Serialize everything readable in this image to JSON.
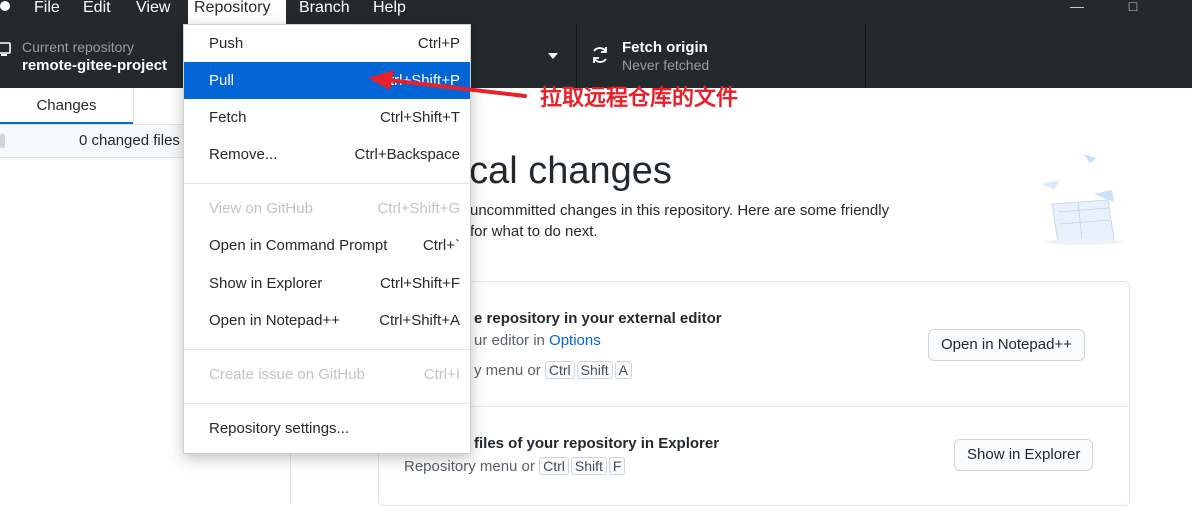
{
  "menubar": {
    "items": [
      "File",
      "Edit",
      "View",
      "Repository",
      "Branch",
      "Help"
    ]
  },
  "toolbar": {
    "current_repo_label": "Current repository",
    "current_repo_value": "remote-gitee-project",
    "fetch_title": "Fetch origin",
    "fetch_subtitle": "Never fetched"
  },
  "sidebar": {
    "tab_changes": "Changes",
    "changed_files": "0 changed files"
  },
  "main": {
    "heading": "ocal changes",
    "description": "uncommitted changes in this repository. Here are some friendly for what to do next.",
    "desc_line1": "uncommitted changes in this repository. Here are some friendly",
    "desc_line2": "for what to do next.",
    "card1": {
      "title": "e repository in your external editor",
      "sub_text": "ur editor in ",
      "sub_link": "Options",
      "menu_text": "y menu or",
      "keys": [
        "Ctrl",
        "Shift",
        "A"
      ],
      "button": "Open in Notepad++"
    },
    "card2": {
      "title": "files of your repository in Explorer",
      "menu_text": "Repository menu or",
      "keys": [
        "Ctrl",
        "Shift",
        "F"
      ],
      "button": "Show in Explorer"
    }
  },
  "dropdown": {
    "items": [
      {
        "label": "Push",
        "shortcut": "Ctrl+P"
      },
      {
        "label": "Pull",
        "shortcut": "Ctrl+Shift+P"
      },
      {
        "label": "Fetch",
        "shortcut": "Ctrl+Shift+T"
      },
      {
        "label": "Remove...",
        "shortcut": "Ctrl+Backspace"
      },
      {
        "label": "View on GitHub",
        "shortcut": "Ctrl+Shift+G"
      },
      {
        "label": "Open in Command Prompt",
        "shortcut": "Ctrl+`"
      },
      {
        "label": "Show in Explorer",
        "shortcut": "Ctrl+Shift+F"
      },
      {
        "label": "Open in Notepad++",
        "shortcut": "Ctrl+Shift+A"
      },
      {
        "label": "Create issue on GitHub",
        "shortcut": "Ctrl+I"
      },
      {
        "label": "Repository settings...",
        "shortcut": ""
      }
    ]
  },
  "annotation": {
    "text": "拉取远程仓库的文件",
    "color": "#e8202a"
  },
  "colors": {
    "titlebar": "#24292e",
    "highlight": "#0366d6"
  }
}
